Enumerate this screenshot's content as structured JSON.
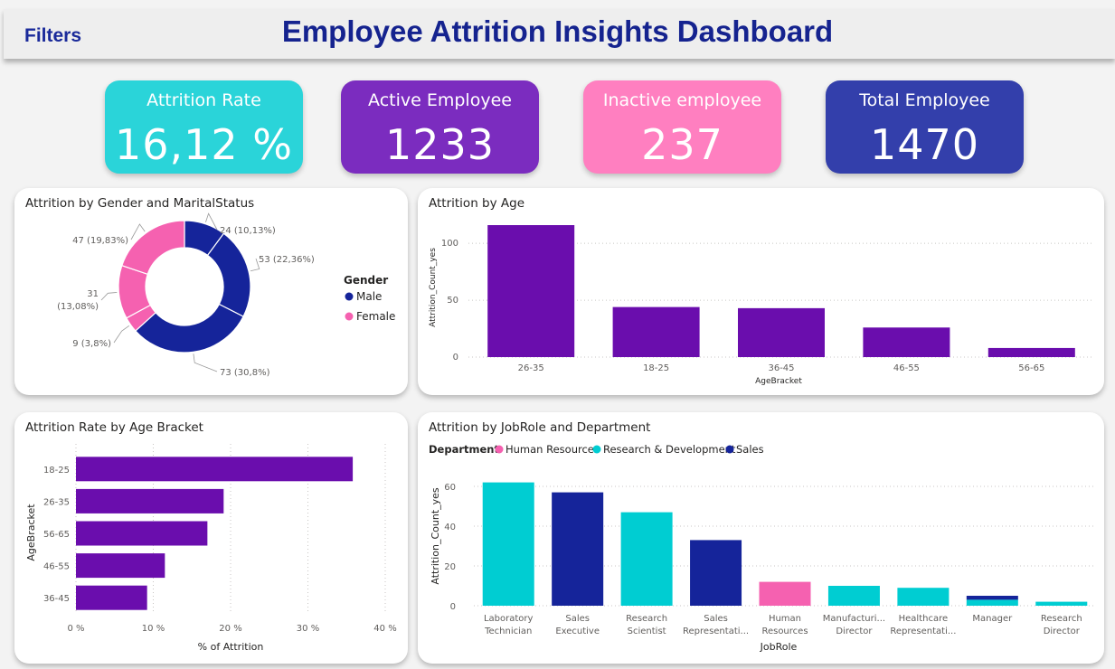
{
  "header": {
    "filters_label": "Filters",
    "title": "Employee Attrition Insights Dashboard"
  },
  "kpis": [
    {
      "label": "Attrition Rate",
      "value": "16,12 %",
      "color": "#2ad4d9"
    },
    {
      "label": "Active Employee",
      "value": "1233",
      "color": "#7b2cbf"
    },
    {
      "label": "Inactive employee",
      "value": "237",
      "color": "#ff7fc0"
    },
    {
      "label": "Total Employee",
      "value": "1470",
      "color": "#333fab"
    }
  ],
  "colors": {
    "male": "#15249a",
    "female": "#f561b0",
    "bar": "#6a0dad",
    "hr": "#f561b0",
    "rnd": "#00cdd2",
    "sales": "#15249a"
  },
  "chart_data": [
    {
      "type": "pie",
      "title": "Attrition by Gender and MaritalStatus",
      "legend_title": "Gender",
      "legend": [
        "Male",
        "Female"
      ],
      "slices": [
        {
          "gender": "Male",
          "value": 24,
          "label": "24 (10,13%)"
        },
        {
          "gender": "Male",
          "value": 53,
          "label": "53 (22,36%)"
        },
        {
          "gender": "Male",
          "value": 73,
          "label": "73 (30,8%)"
        },
        {
          "gender": "Female",
          "value": 9,
          "label": "9 (3,8%)"
        },
        {
          "gender": "Female",
          "value": 31,
          "label": "31 (13,08%)"
        },
        {
          "gender": "Female",
          "value": 47,
          "label": "47 (19,83%)"
        }
      ]
    },
    {
      "type": "bar",
      "title": "Attrition by Age",
      "categories": [
        "26-35",
        "18-25",
        "36-45",
        "46-55",
        "56-65"
      ],
      "values": [
        116,
        44,
        43,
        26,
        8
      ],
      "xlabel": "AgeBracket",
      "ylabel": "Attrition_Count_yes",
      "ylim": [
        0,
        116
      ],
      "yticks": [
        0,
        50,
        100
      ]
    },
    {
      "type": "bar",
      "orientation": "horizontal",
      "title": "Attrition Rate by Age Bracket",
      "categories": [
        "18-25",
        "26-35",
        "56-65",
        "46-55",
        "36-45"
      ],
      "values": [
        35.8,
        19.1,
        17.0,
        11.5,
        9.2
      ],
      "xlabel": "% of Attrition",
      "ylabel": "AgeBracket",
      "xlim": [
        0,
        40
      ],
      "xticks": [
        "0 %",
        "10 %",
        "20 %",
        "30 %",
        "40 %"
      ]
    },
    {
      "type": "bar",
      "stacked": true,
      "title": "Attrition by JobRole and Department",
      "legend_title": "Department",
      "categories": [
        "Laboratory Technician",
        "Sales Executive",
        "Research Scientist",
        "Sales Representati...",
        "Human Resources",
        "Manufacturi... Director",
        "Healthcare Representati...",
        "Manager",
        "Research Director"
      ],
      "series": [
        {
          "name": "Human Resources",
          "values": [
            0,
            0,
            0,
            0,
            12,
            0,
            0,
            0,
            0
          ]
        },
        {
          "name": "Research & Development",
          "values": [
            62,
            0,
            47,
            0,
            0,
            10,
            9,
            3,
            2
          ]
        },
        {
          "name": "Sales",
          "values": [
            0,
            57,
            0,
            33,
            0,
            0,
            0,
            2,
            0
          ]
        }
      ],
      "xlabel": "JobRole",
      "ylabel": "Attrition_Count_yes",
      "ylim": [
        0,
        65
      ],
      "yticks": [
        0,
        20,
        40,
        60
      ]
    }
  ]
}
